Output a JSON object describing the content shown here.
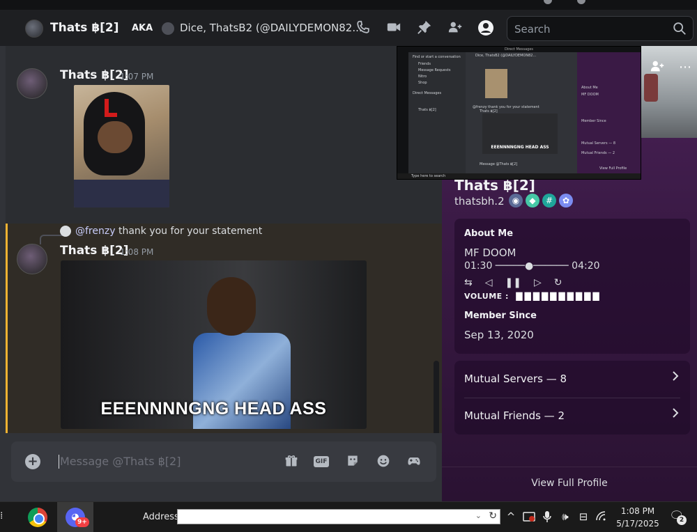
{
  "header": {
    "title": "Thats ฿[2]",
    "aka_label": "AKA",
    "group_names": "Dice, ThatsB2 (@DAILYDEMON82...",
    "search_placeholder": "Search",
    "icons": [
      "phone-call-icon",
      "video-call-icon",
      "pin-icon",
      "add-member-icon",
      "user-profile-icon",
      "search-icon"
    ]
  },
  "messages": [
    {
      "author": "Thats ฿[2]",
      "time": "1:07 PM",
      "attachment": "image"
    },
    {
      "reply_to": "@frenzy",
      "reply_text": "thank you for your statement",
      "author": "Thats ฿[2]",
      "time": "1:08 PM",
      "gif_caption": "EEENNNNGNG HEAD ASS"
    }
  ],
  "composer": {
    "placeholder": "Message @Thats ฿[2]",
    "gif_label": "GIF",
    "icons": [
      "attach-plus-icon",
      "gift-icon",
      "gif-icon",
      "sticker-icon",
      "emoji-icon",
      "activity-icon"
    ]
  },
  "profile": {
    "display_name": "Thats ฿[2]",
    "username": "thatsbh.2",
    "about_heading": "About Me",
    "about_line1": "MF DOOM",
    "about_progress": "01:30 ─────●────── 04:20",
    "player_controls": [
      "⇆",
      "◁",
      "❚❚",
      "▷",
      "↻"
    ],
    "volume_label": "VOLUME :",
    "volume_blocks": "▇▇▇▇▇▇▇▇▇▇",
    "member_since_heading": "Member Since",
    "member_since": "Sep 13, 2020",
    "mutual_servers": "Mutual Servers — 8",
    "mutual_friends": "Mutual Friends — 2",
    "view_full_profile": "View Full Profile"
  },
  "thumbnail": {
    "window_title": "Direct Messages",
    "find_text": "Find or start a conversation",
    "nav": [
      "Friends",
      "Message Requests",
      "Nitro",
      "Shop"
    ],
    "dm_heading": "Direct Messages",
    "dm_item": "Thats ฿[2]",
    "header_text": "Dice, ThatsB2 (@DAILYDEMON82...",
    "reply_text": "@frenzy thank you for your statement",
    "author": "Thats ฿[2]",
    "caption": "EEENNNNGNG HEAD ASS",
    "composer": "Message @Thats ฿[2]",
    "profile_about": "About Me",
    "profile_doom": "MF DOOM",
    "profile_since": "Member Since",
    "profile_servers": "Mutual Servers — 8",
    "profile_friends": "Mutual Friends — 2",
    "profile_view": "View Full Profile",
    "taskbar_search": "Type here to search"
  },
  "taskbar": {
    "address_label": "Address",
    "discord_badge": "9+",
    "time": "1:08 PM",
    "date": "5/17/2025",
    "notification_count": "2"
  }
}
